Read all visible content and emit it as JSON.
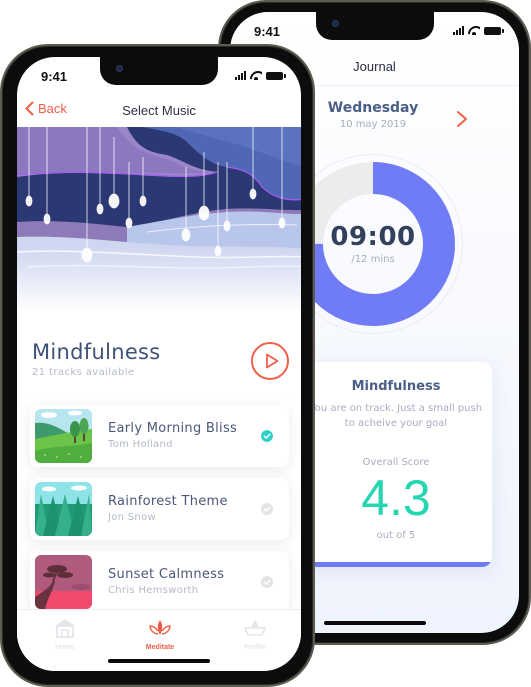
{
  "colors": {
    "accent": "#f0604a",
    "ring_fill": "#6f7cf6",
    "ring_track": "#ececec",
    "score": "#26d6b0",
    "check_active": "#2fd0c8",
    "check_inactive": "#e3e3e6",
    "title_text": "#3f5277"
  },
  "journal_screen": {
    "status_time": "9:41",
    "header_title": "Journal",
    "day_name": "Wednesday",
    "date": "10 may 2019",
    "next_icon": "chevron-right-icon",
    "timer": {
      "elapsed": "09:00",
      "total_label": "/12 mins",
      "progress_fraction": 0.75
    },
    "score_card": {
      "title": "Mindfulness",
      "message": "You are on track. Just a small push to acheive your goal",
      "score_label": "Overall Score",
      "score_value": "4.3",
      "score_out_of": "out of 5"
    }
  },
  "music_screen": {
    "status_time": "9:41",
    "back_label": "Back",
    "nav_title": "Select Music",
    "category_title": "Mindfulness",
    "tracks_available": "21 tracks available",
    "play_icon": "play-circle-icon",
    "tracks": [
      {
        "title": "Early Morning Bliss",
        "artist": "Tom Holland",
        "selected": true,
        "thumb": "meadow-trees"
      },
      {
        "title": "Rainforest Theme",
        "artist": "Jon Snow",
        "selected": false,
        "thumb": "pine-forest"
      },
      {
        "title": "Sunset Calmness",
        "artist": "Chris Hemsworth",
        "selected": false,
        "thumb": "sunset-tree"
      }
    ],
    "tab_bar": [
      {
        "label": "Home",
        "icon": "home-icon",
        "active": false
      },
      {
        "label": "Meditate",
        "icon": "lotus-icon",
        "active": true
      },
      {
        "label": "Profile",
        "icon": "profile-icon",
        "active": false
      }
    ]
  }
}
